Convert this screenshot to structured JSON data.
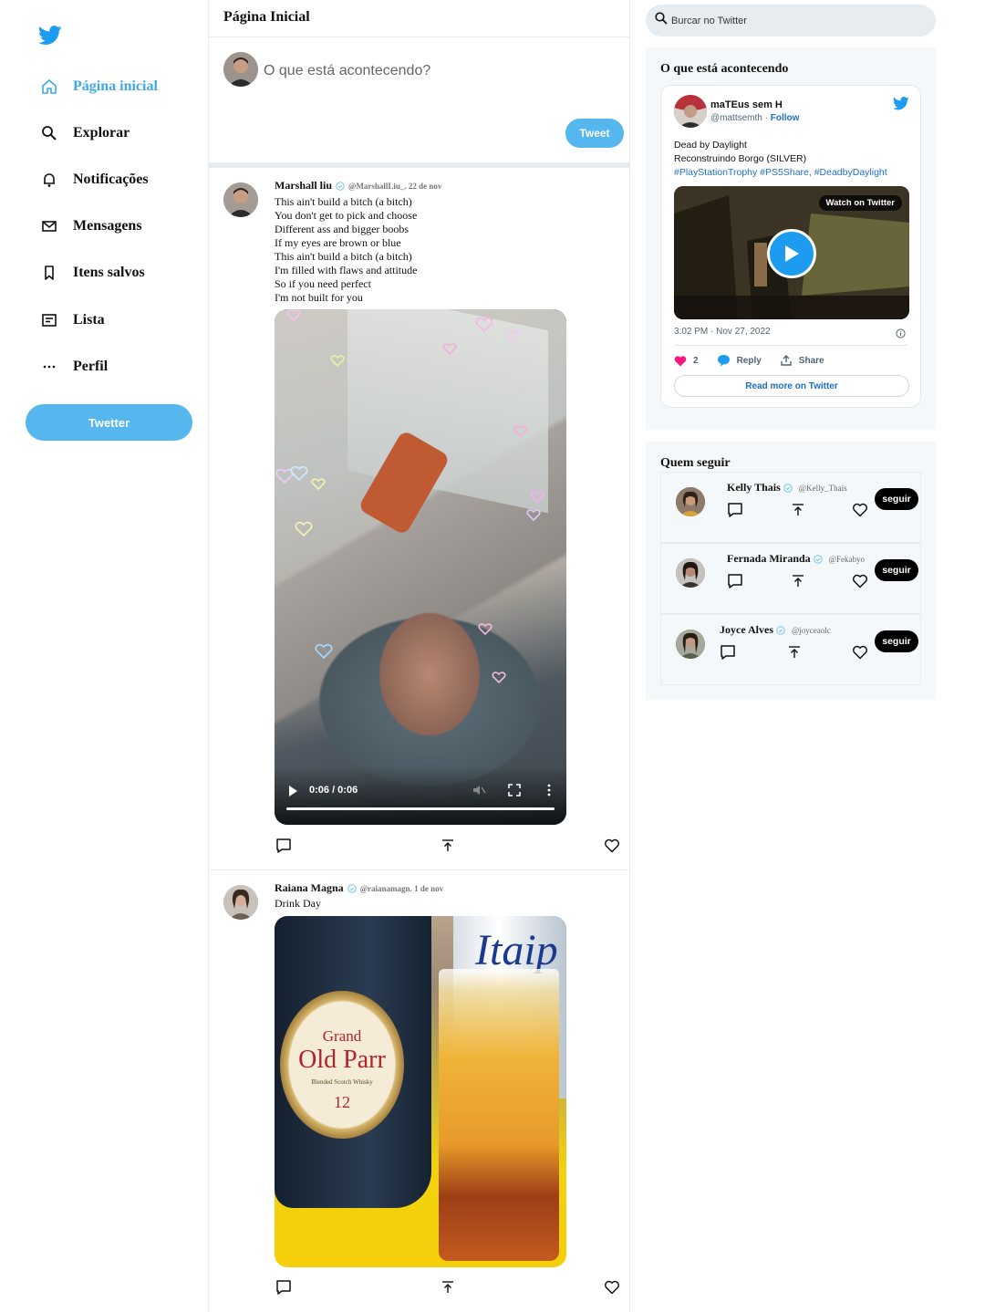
{
  "colors": {
    "accent": "#1d9bf0",
    "button_blue": "#55b7ee",
    "active_nav": "#3fa9e8"
  },
  "sidebar": {
    "logo_icon": "twitter-bird-icon",
    "items": [
      {
        "label": "Página inicial",
        "icon": "home-icon",
        "active": true
      },
      {
        "label": "Explorar",
        "icon": "search-icon"
      },
      {
        "label": "Notificações",
        "icon": "bell-icon"
      },
      {
        "label": "Mensagens",
        "icon": "mail-icon"
      },
      {
        "label": "Itens salvos",
        "icon": "bookmark-icon"
      },
      {
        "label": "Lista",
        "icon": "list-icon"
      },
      {
        "label": "Perfil",
        "icon": "more-icon"
      }
    ],
    "button_label": "Twetter"
  },
  "main": {
    "header_title": "Página Inicial",
    "composer": {
      "placeholder": "O que está acontecendo?",
      "button_label": "Tweet"
    },
    "posts": [
      {
        "name": "Marshall liu",
        "handle": "@MarshallLiu_",
        "date": ". 22 de nov",
        "lines": [
          "This ain't build a bitch (a bitch)",
          "You don't get to pick and choose",
          "Different ass and bigger boobs",
          "If my eyes are brown or blue",
          "This ain't build a bitch (a bitch)",
          "I'm filled with flaws and attitude",
          "So if you need perfect",
          "I'm not built for you"
        ],
        "video": {
          "time": "0:06 / 0:06",
          "progress": 1.0
        }
      },
      {
        "name": "Raiana Magna",
        "handle": "@raianamagn",
        "date": ". 1 de nov",
        "lines": [
          "Drink Day"
        ],
        "image_text": {
          "brand_top": "Grand",
          "brand_main": "Old Parr",
          "brand_sub": "Blended Scotch Whisky",
          "age": "12",
          "can": "Itaip"
        }
      }
    ]
  },
  "right": {
    "search_placeholder": "Burcar no Twitter",
    "trending": {
      "title": "O que está acontecendo",
      "embed": {
        "name": "maTEus sem H",
        "handle": "@mattsemth",
        "separator": " · ",
        "follow": "Follow",
        "text_lines": [
          "Dead by Daylight",
          "Reconstruindo Borgo (SILVER)"
        ],
        "tags": "#PlayStationTrophy #PS5Share, #DeadbyDaylight",
        "watch_label": "Watch on Twitter",
        "timestamp": "3:02 PM · Nov 27, 2022",
        "likes": "2",
        "reply": "Reply",
        "share": "Share",
        "read_more": "Read more on Twitter"
      }
    },
    "who_to_follow": {
      "title": "Quem seguir",
      "users": [
        {
          "name": "Kelly Thais",
          "handle": "@Kelly_Thais",
          "button": "seguir"
        },
        {
          "name": "Fernada Miranda",
          "handle": "@Fekabyo",
          "button": "seguir"
        },
        {
          "name": "Joyce Alves",
          "handle": "@joyceaolc",
          "button": "seguir"
        }
      ]
    }
  }
}
